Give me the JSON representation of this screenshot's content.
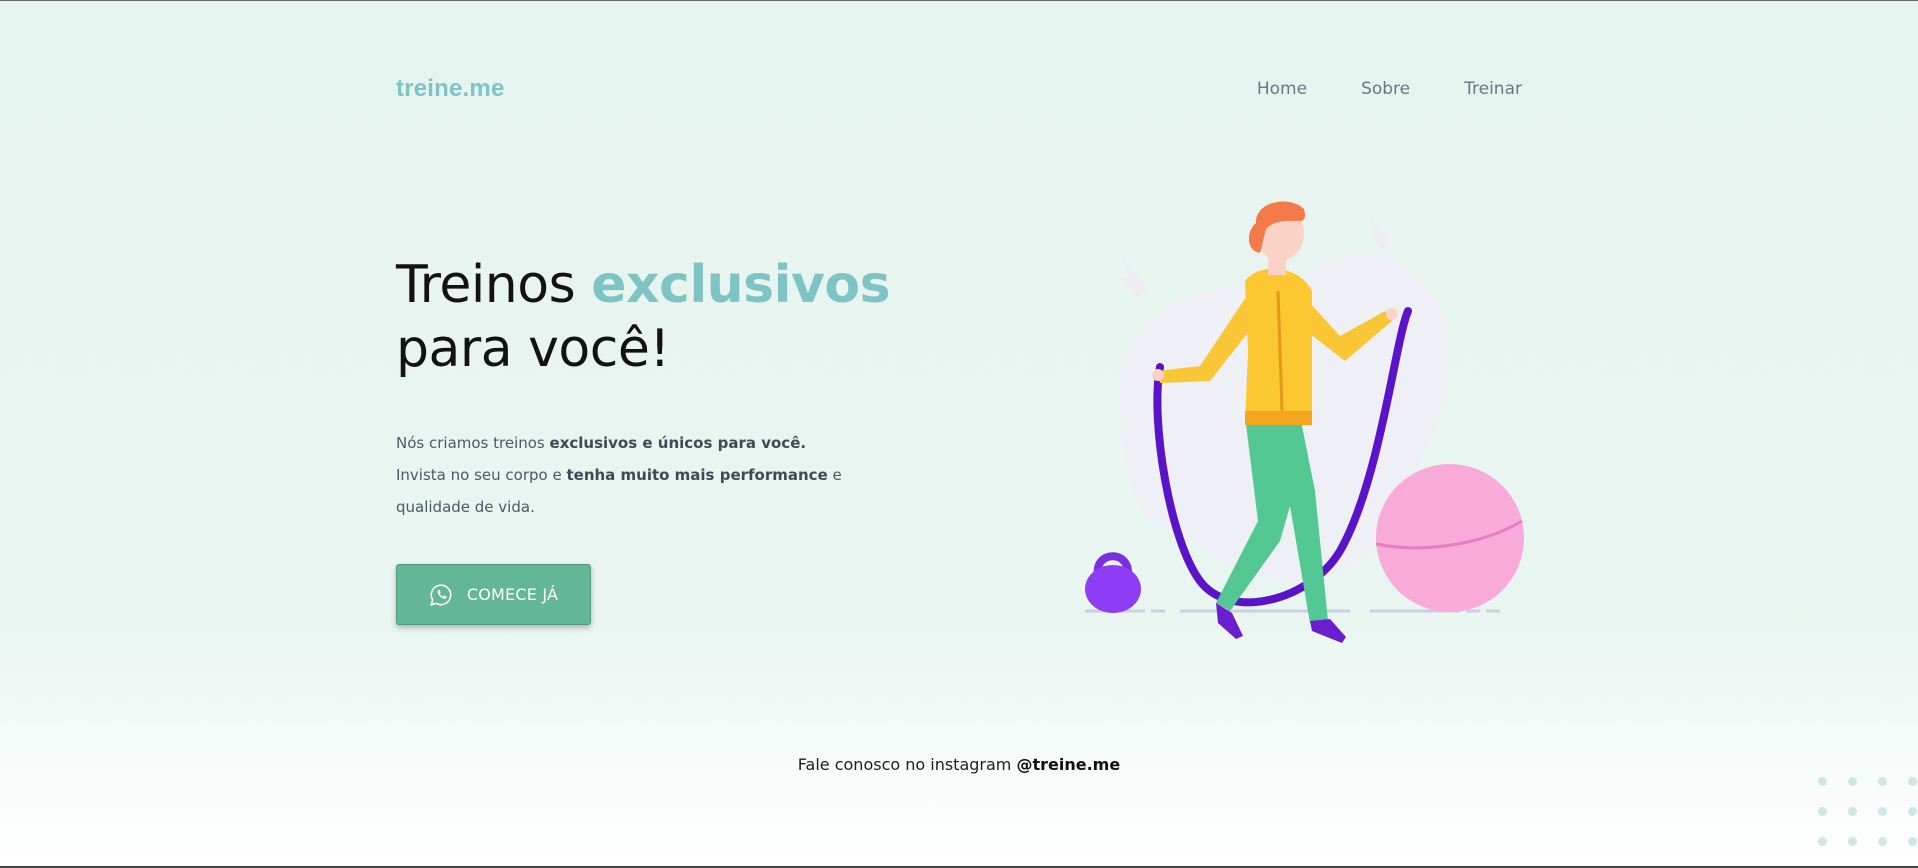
{
  "header": {
    "logo": "treine.me",
    "nav": [
      {
        "label": "Home"
      },
      {
        "label": "Sobre"
      },
      {
        "label": "Treinar"
      }
    ]
  },
  "hero": {
    "title_part1": "Treinos ",
    "title_accent": "exclusivos",
    "title_part2": "para você!",
    "p1_plain": "Nós criamos treinos ",
    "p1_bold": "exclusivos e únicos para você.",
    "p2_plain": "Invista no seu corpo e ",
    "p2_bold": "tenha muito mais performance",
    "p2_end": " e",
    "p3_plain": "qualidade de vida.",
    "cta_label": "COMECE JÁ",
    "cta_icon": "whatsapp-icon"
  },
  "footer": {
    "text": "Fale conosco no instagram ",
    "handle": "@treine.me"
  },
  "colors": {
    "accent": "#7fc4c4",
    "cta": "#63b796",
    "background": "#e6f4ef"
  }
}
